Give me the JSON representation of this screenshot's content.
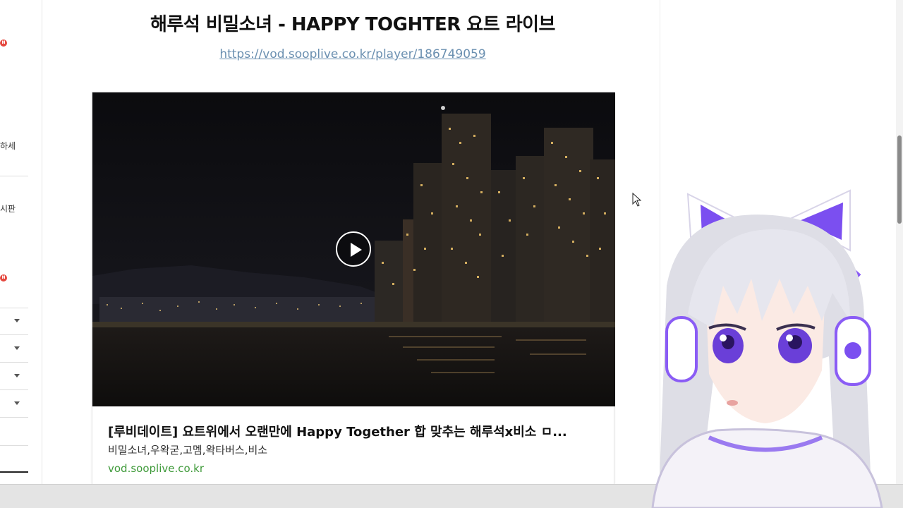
{
  "post": {
    "title": "해루석 비밀소녀 - HAPPY TOGHTER 요트 라이브",
    "link": "https://vod.sooplive.co.kr/player/186749059"
  },
  "card": {
    "title": "[루비데이트] 요트위에서 오랜만에 Happy Together 합 맞추는 해루석x비소 ㅁ...",
    "desc": "비밀소녀,우왁굳,고멤,왁타버스,비소",
    "domain": "vod.sooplive.co.kr"
  },
  "sidebar": {
    "badge_new_1": "N",
    "badge_new_2": "N",
    "item_1": "하세",
    "item_2": "시판"
  },
  "icons": [
    "play-icon",
    "chevron-down-icon",
    "mouse-cursor-icon"
  ],
  "colors": {
    "link": "#6a8fb0",
    "domain": "#3f9a3a",
    "badge": "#e5483f",
    "avatar_accent": "#7b4ff0"
  }
}
